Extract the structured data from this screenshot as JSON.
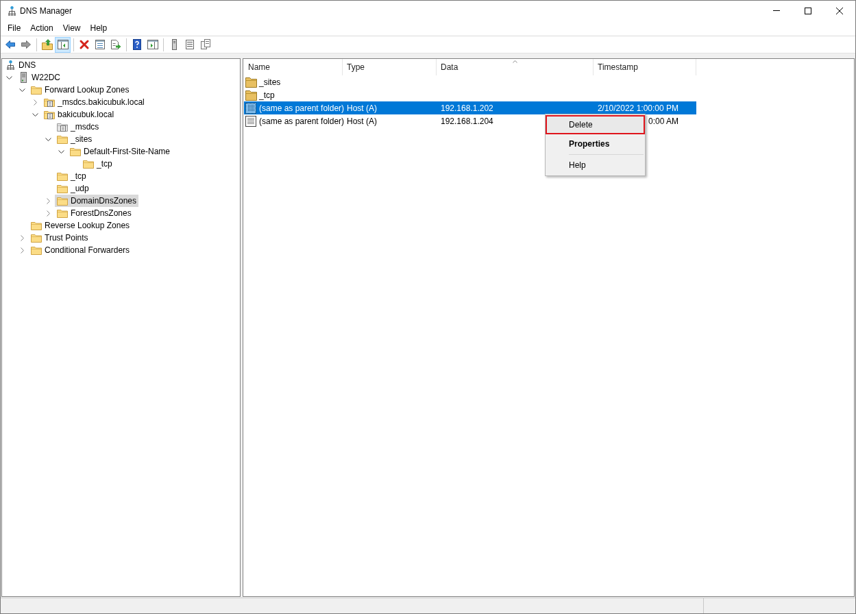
{
  "window": {
    "title": "DNS Manager"
  },
  "menu_bar": [
    "File",
    "Action",
    "View",
    "Help"
  ],
  "toolbar": [
    {
      "kind": "back",
      "pressed": false,
      "disabled": false
    },
    {
      "kind": "forward",
      "pressed": false,
      "disabled": true
    },
    {
      "kind": "separator"
    },
    {
      "kind": "up",
      "pressed": false,
      "disabled": false
    },
    {
      "kind": "tree",
      "pressed": true,
      "disabled": false
    },
    {
      "kind": "separator"
    },
    {
      "kind": "delete",
      "pressed": false,
      "disabled": false
    },
    {
      "kind": "properties",
      "pressed": false,
      "disabled": false
    },
    {
      "kind": "export",
      "pressed": false,
      "disabled": false
    },
    {
      "kind": "separator"
    },
    {
      "kind": "help",
      "pressed": false,
      "disabled": false
    },
    {
      "kind": "pane",
      "pressed": false,
      "disabled": false
    },
    {
      "kind": "separator"
    },
    {
      "kind": "server",
      "pressed": false,
      "disabled": false
    },
    {
      "kind": "list",
      "pressed": false,
      "disabled": false
    },
    {
      "kind": "copy",
      "pressed": false,
      "disabled": false
    }
  ],
  "tree": {
    "items": [
      {
        "label": "DNS",
        "kind": "dns",
        "selected": false,
        "children": [
          {
            "label": "W22DC",
            "kind": "server",
            "expanded": true,
            "selected": false,
            "children": [
              {
                "label": "Forward Lookup Zones",
                "kind": "folder",
                "expanded": true,
                "selected": false,
                "children": [
                  {
                    "label": "_msdcs.bakicubuk.local",
                    "kind": "zone",
                    "expanded": false,
                    "selected": false
                  },
                  {
                    "label": "bakicubuk.local",
                    "kind": "zone",
                    "expanded": true,
                    "selected": false,
                    "children": [
                      {
                        "label": "_msdcs",
                        "kind": "delegation",
                        "selected": false
                      },
                      {
                        "label": "_sites",
                        "kind": "folder",
                        "expanded": true,
                        "selected": false,
                        "children": [
                          {
                            "label": "Default-First-Site-Name",
                            "kind": "folder",
                            "expanded": true,
                            "selected": false,
                            "children": [
                              {
                                "label": "_tcp",
                                "kind": "folder",
                                "selected": false
                              }
                            ]
                          }
                        ]
                      },
                      {
                        "label": "_tcp",
                        "kind": "folder",
                        "selected": false
                      },
                      {
                        "label": "_udp",
                        "kind": "folder",
                        "selected": false
                      },
                      {
                        "label": "DomainDnsZones",
                        "kind": "folder",
                        "expanded": false,
                        "selected": true
                      },
                      {
                        "label": "ForestDnsZones",
                        "kind": "folder",
                        "expanded": false,
                        "selected": false
                      }
                    ]
                  }
                ]
              },
              {
                "label": "Reverse Lookup Zones",
                "kind": "folder",
                "selected": false
              },
              {
                "label": "Trust Points",
                "kind": "folder",
                "expanded": false,
                "selected": false
              },
              {
                "label": "Conditional Forwarders",
                "kind": "folder",
                "expanded": false,
                "selected": false
              }
            ]
          }
        ]
      }
    ]
  },
  "list": {
    "columns": [
      {
        "label": "Name",
        "sorted": false
      },
      {
        "label": "Type",
        "sorted": false
      },
      {
        "label": "Data",
        "sorted": true
      },
      {
        "label": "Timestamp",
        "sorted": false
      }
    ],
    "rows": [
      {
        "kind": "folder",
        "cells": [
          "_sites"
        ],
        "selected": false
      },
      {
        "kind": "folder",
        "cells": [
          "_tcp"
        ],
        "selected": false
      },
      {
        "kind": "record",
        "cells": [
          "(same as parent folder)",
          "Host (A)",
          "192.168.1.202",
          "2/10/2022 1:00:00 PM"
        ],
        "selected": true
      },
      {
        "kind": "record",
        "cells": [
          "(same as parent folder)",
          "Host (A)",
          "192.168.1.204",
          "0:00 AM"
        ],
        "selected": false
      }
    ]
  },
  "context_menu": {
    "items": [
      {
        "kind": "item",
        "label": "Delete",
        "default": false,
        "highlighted": true
      },
      {
        "kind": "item",
        "label": "Properties",
        "default": true,
        "highlighted": false
      },
      {
        "kind": "separator"
      },
      {
        "kind": "item",
        "label": "Help",
        "default": false,
        "highlighted": false
      }
    ]
  }
}
